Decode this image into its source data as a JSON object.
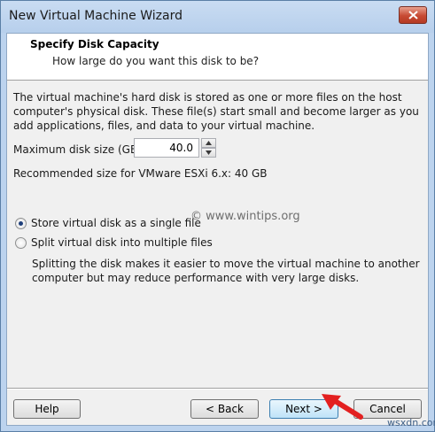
{
  "window": {
    "title": "New Virtual Machine Wizard"
  },
  "header": {
    "title": "Specify Disk Capacity",
    "subtitle": "How large do you want this disk to be?"
  },
  "body": {
    "description": "The virtual machine's hard disk is stored as one or more files on the host computer's physical disk. These file(s) start small and become larger as you add applications, files, and data to your virtual machine.",
    "max_size_label": "Maximum disk size (GB):",
    "max_size_value": "40.0",
    "recommended": "Recommended size for VMware ESXi 6.x: 40 GB",
    "options": [
      {
        "label": "Store virtual disk as a single file",
        "selected": true
      },
      {
        "label": "Split virtual disk into multiple files",
        "selected": false
      }
    ],
    "split_note": "Splitting the disk makes it easier to move the virtual machine to another computer but may reduce performance with very large disks.",
    "watermark": "© www.wintips.org"
  },
  "footer": {
    "help": "Help",
    "back": "< Back",
    "next": "Next >",
    "cancel": "Cancel"
  },
  "corner_watermark": "wsxdn.com",
  "colors": {
    "title_bar": "#bcd3ee",
    "close_button": "#c74a33",
    "annotation_arrow": "#e32020"
  }
}
